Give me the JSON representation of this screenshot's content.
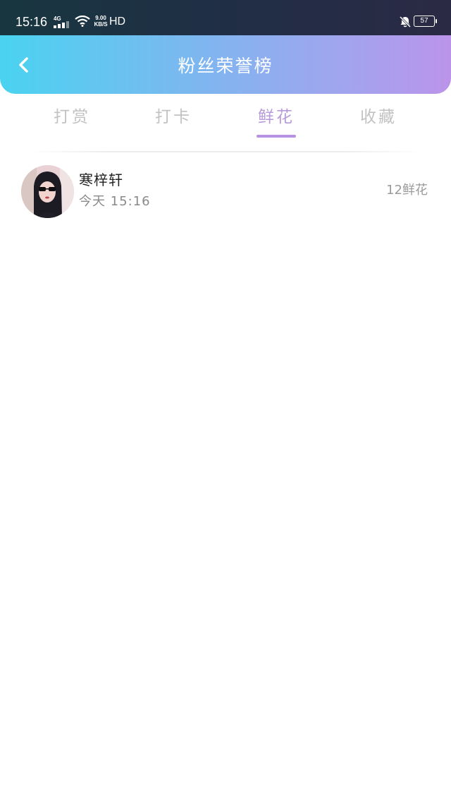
{
  "status_bar": {
    "time": "15:16",
    "network_type": "4G",
    "speed_value": "9.00",
    "speed_unit": "KB/S",
    "hd_label": "HD",
    "battery": "57"
  },
  "header": {
    "title": "粉丝荣誉榜",
    "back_icon": "chevron-left-icon"
  },
  "tabs": [
    {
      "label": "打赏",
      "active": false
    },
    {
      "label": "打卡",
      "active": false
    },
    {
      "label": "鲜花",
      "active": true
    },
    {
      "label": "收藏",
      "active": false
    }
  ],
  "list": [
    {
      "name": "寒梓轩",
      "time": "今天 15:16",
      "count": "12鲜花"
    }
  ],
  "colors": {
    "header_gradient_start": "#4ad3f1",
    "header_gradient_end": "#bb94ea",
    "active_tab": "#b69ad9",
    "inactive_tab": "#c2c2c2"
  }
}
